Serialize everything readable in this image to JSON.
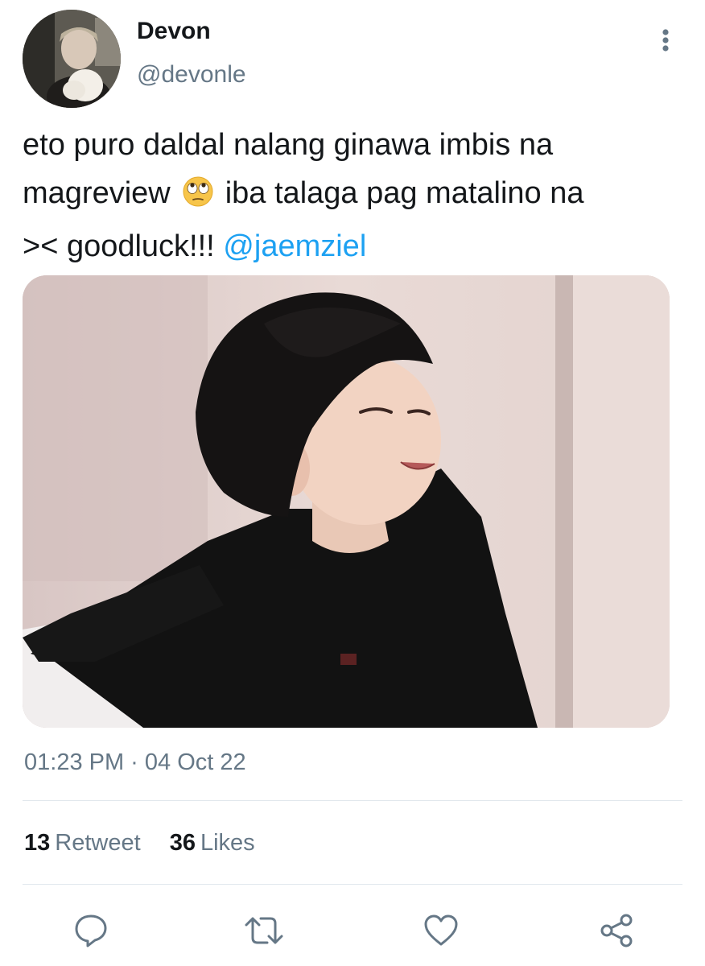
{
  "author": {
    "display_name": "Devon",
    "handle": "@devonle",
    "avatar_icon": "profile-photo"
  },
  "tweet": {
    "text_line1": "eto puro daldal nalang ginawa imbis na",
    "text_line2_before_emoji": "magreview",
    "emoji": "face-with-rolling-eyes",
    "text_line2_after_emoji": "iba talaga pag matalino na",
    "text_line3": "><  goodluck!!!",
    "mention": "@jaemziel"
  },
  "media": {
    "icon": "photo-of-person-in-black-sweater"
  },
  "meta": {
    "timestamp": "01:23 PM · 04 Oct 22"
  },
  "stats": {
    "retweets_count": "13",
    "retweets_label": "Retweet",
    "likes_count": "36",
    "likes_label": "Likes"
  },
  "actions": {
    "reply_icon": "reply-icon",
    "retweet_icon": "retweet-icon",
    "like_icon": "heart-icon",
    "share_icon": "share-icon",
    "more_icon": "more-vertical-icon"
  },
  "colors": {
    "text": "#14171a",
    "secondary": "#657786",
    "link": "#1da1f2",
    "divider": "#e1e8ed"
  }
}
